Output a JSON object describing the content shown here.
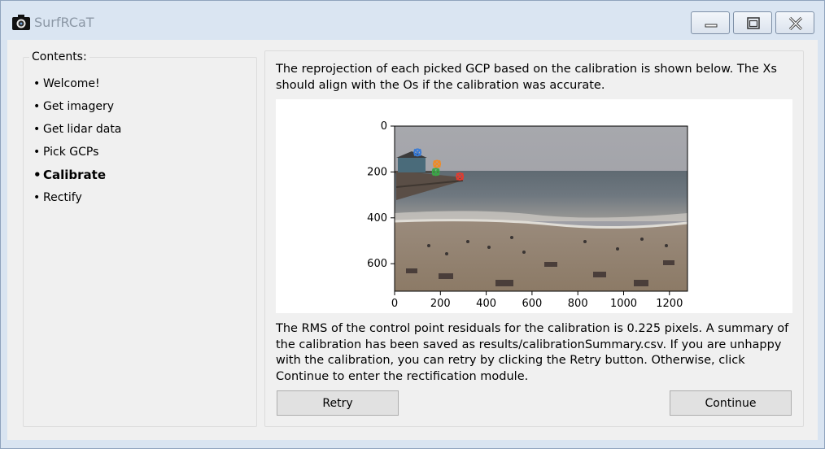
{
  "window": {
    "title": "SurfRCaT",
    "icon": "camera-icon",
    "controls": [
      "minimize-icon",
      "maximize-icon",
      "close-icon"
    ]
  },
  "sidebar": {
    "title": "Contents:",
    "items": [
      {
        "label": "Welcome!",
        "active": false
      },
      {
        "label": "Get imagery",
        "active": false
      },
      {
        "label": "Get lidar data",
        "active": false
      },
      {
        "label": "Pick GCPs",
        "active": false
      },
      {
        "label": "Calibrate",
        "active": true
      },
      {
        "label": "Rectify",
        "active": false
      }
    ]
  },
  "main": {
    "intro_text": "The reprojection of each picked GCP based on the calibration is shown below. The Xs should align with the Os if the calibration was accurate.",
    "summary_text": "The RMS of the control point residuals for the calibration is 0.225 pixels. A summary of the calibration has been saved as results/calibrationSummary.csv. If you are unhappy with the calibration, you can retry by clicking the Retry button. Otherwise, click Continue to enter the rectification module.",
    "retry_label": "Retry",
    "continue_label": "Continue"
  },
  "figure": {
    "x_ticks": [
      "0",
      "200",
      "400",
      "600",
      "800",
      "1000",
      "1200"
    ],
    "y_ticks": [
      "0",
      "200",
      "400",
      "600"
    ],
    "gcps": [
      {
        "x": 100,
        "y": 115,
        "color": "#3a7bd5"
      },
      {
        "x": 185,
        "y": 165,
        "color": "#f08a24"
      },
      {
        "x": 180,
        "y": 200,
        "color": "#3aa845"
      },
      {
        "x": 285,
        "y": 220,
        "color": "#e03c31"
      }
    ]
  }
}
